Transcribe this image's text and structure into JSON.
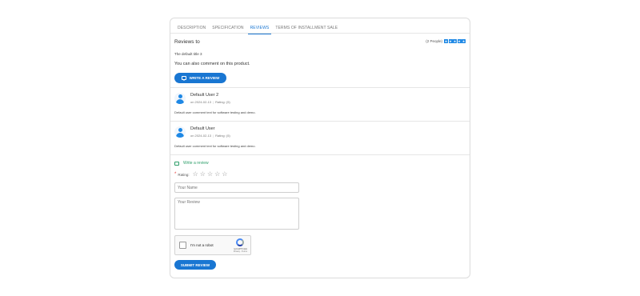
{
  "tabs": [
    {
      "label": "DESCRIPTION",
      "active": false
    },
    {
      "label": "SPECIFICATION",
      "active": false
    },
    {
      "label": "REVIEWS",
      "active": true
    },
    {
      "label": "TERMS OF INSTALLMENT SALE",
      "active": false
    }
  ],
  "reviews_header": {
    "title": "Reviews to",
    "people_count": "(2 People)",
    "rating": 5
  },
  "product": {
    "default_title": "The default title 3",
    "comment_note": "You can also comment on this product."
  },
  "write_review_button": "WRITE A REVIEW",
  "reviews": [
    {
      "name": "Default User 2",
      "date": "on 2024-02-13",
      "rating": "Rating: (5)",
      "comment": "Default user comment text for software testing and demo."
    },
    {
      "name": "Default User",
      "date": "on 2024-02-13",
      "rating": "Rating: (5)",
      "comment": "Default user comment text for software testing and demo."
    }
  ],
  "form": {
    "heading": "Write a review",
    "required_mark": "*",
    "rating_label": "Rating:",
    "star_count": 5,
    "name_placeholder": "Your Name",
    "review_placeholder": "Your Review",
    "captcha_label": "I'm not a robot",
    "captcha_brand": "reCAPTCHA",
    "captcha_links": "Privacy - Terms",
    "submit_label": "SUBMIT REVIEW"
  },
  "colors": {
    "accent": "#1976d2",
    "form_heading": "#2e9e6a",
    "required": "#e53935"
  }
}
